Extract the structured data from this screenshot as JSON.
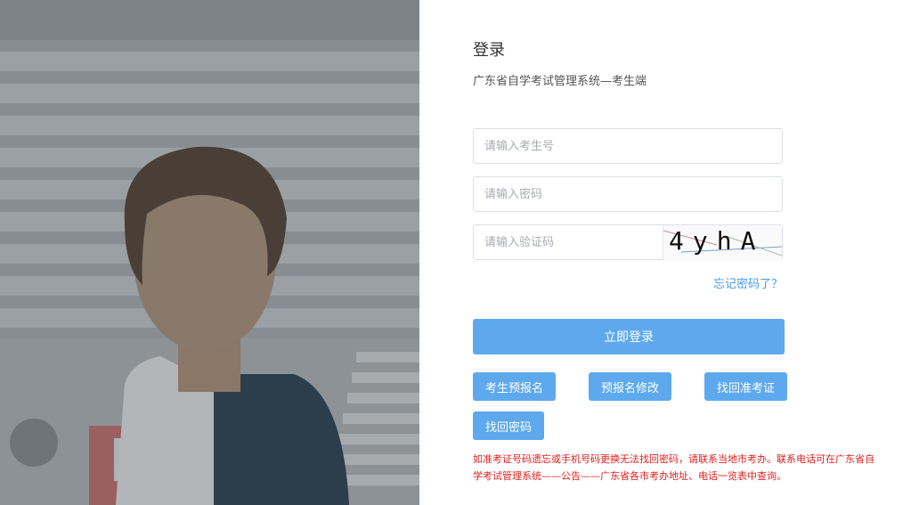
{
  "login": {
    "title": "登录",
    "subtitle": "广东省自学考试管理系统—考生端",
    "candidate_placeholder": "请输入考生号",
    "password_placeholder": "请输入密码",
    "captcha_placeholder": "请输入验证码",
    "captcha_text": "4yhA",
    "forgot_password": "忘记密码了？",
    "submit": "立即登录",
    "actions": [
      "考生预报名",
      "预报名修改",
      "找回准考证",
      "找回密码"
    ],
    "notice": "如准考证号码遗忘或手机号码更换无法找回密码，请联系当地市考办。联系电话可在广东省自学考试管理系统——公告——广东省各市考办地址、电话一览表中查询。"
  }
}
